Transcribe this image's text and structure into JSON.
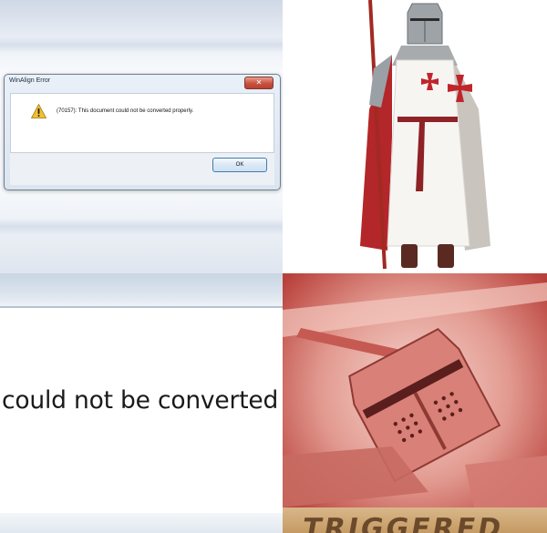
{
  "dialog": {
    "title": "WinAlign Error",
    "close_label": "✕",
    "message": "(70157): This document could not be converted properly.",
    "ok_label": "OK"
  },
  "zoom": {
    "text": "could not be converted"
  },
  "triggered": {
    "text": "TRIGGERED"
  },
  "icons": {
    "warning": "warning-icon"
  },
  "colors": {
    "templar_red": "#c0252b",
    "dialog_frame": "#dbe5f0",
    "triggered_tint": "#e9b0a8"
  }
}
